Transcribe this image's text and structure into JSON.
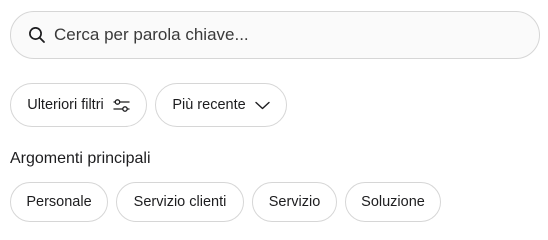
{
  "search": {
    "placeholder": "Cerca per parola chiave...",
    "value": "",
    "icon": "search-icon"
  },
  "filters": {
    "more_filters_label": "Ulteriori filtri",
    "more_filters_icon": "sliders-icon",
    "sort_label": "Più recente",
    "sort_icon": "chevron-down-icon"
  },
  "topics": {
    "title": "Argomenti principali",
    "items": [
      "Personale",
      "Servizio clienti",
      "Servizio",
      "Soluzione"
    ]
  },
  "colors": {
    "border": "#d6d6d6",
    "text": "#1d1d1f",
    "search_background": "#fafafa"
  }
}
